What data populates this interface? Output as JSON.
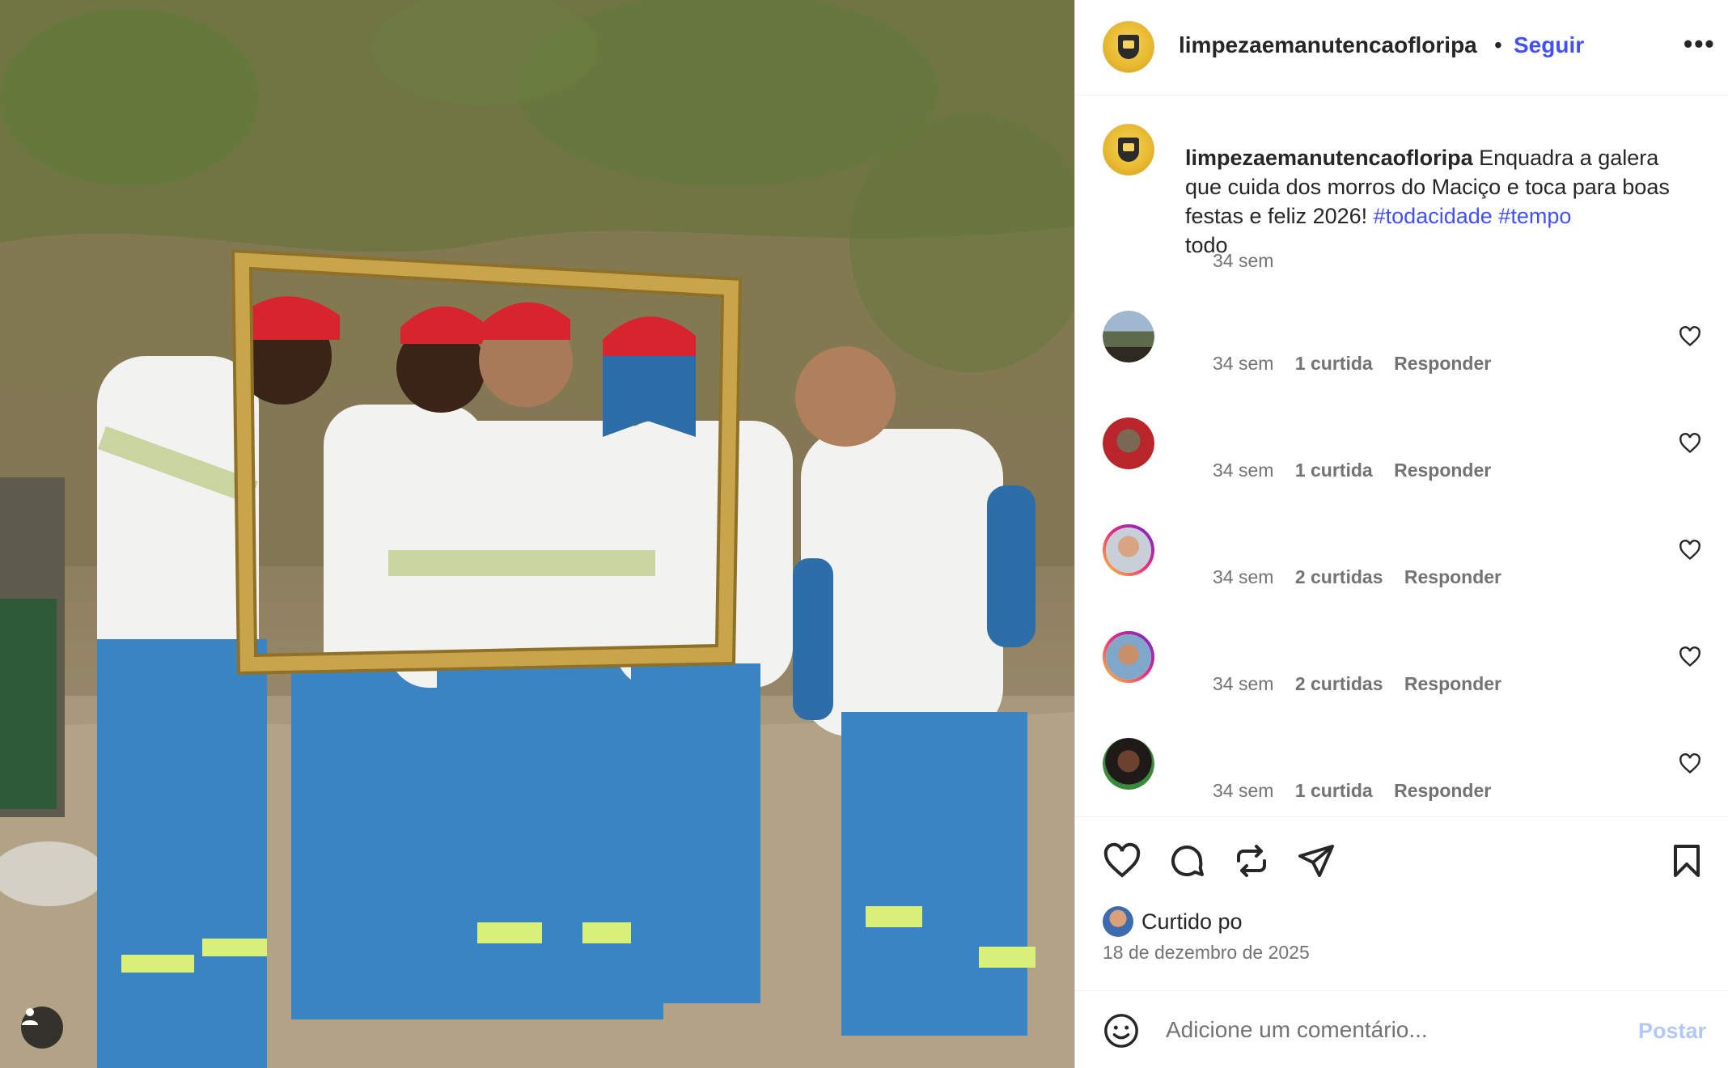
{
  "post": {
    "photo_alt": "",
    "username": "limpezaemanutencaofloripa",
    "dot": "•",
    "follow_label": "Seguir",
    "more_label": "•••"
  },
  "caption": {
    "username": "limpezaemanutencaofloripa",
    "text": " Enquadra a galera que cuida dos morros do Maciço e toca para boas festas e feliz 2026! ",
    "tag1": "#todacidade",
    "tag2": "#tempo",
    "tail": " todo",
    "time": "34 sem"
  },
  "comments": [
    {
      "time": "34 sem",
      "likes": "1 curtida",
      "reply": "Responder",
      "avatar": "landscape",
      "ring": false
    },
    {
      "time": "34 sem",
      "likes": "1 curtida",
      "reply": "Responder",
      "avatar": "dog-red",
      "ring": false
    },
    {
      "time": "34 sem",
      "likes": "2 curtidas",
      "reply": "Responder",
      "avatar": "man-tan",
      "ring": true
    },
    {
      "time": "34 sem",
      "likes": "2 curtidas",
      "reply": "Responder",
      "avatar": "man-bald",
      "ring": true
    },
    {
      "time": "34 sem",
      "likes": "1 curtida",
      "reply": "Responder",
      "avatar": "woman-curly",
      "ring": false
    }
  ],
  "actions": {
    "like": "heart-icon",
    "comment": "comment-icon",
    "repost": "repost-icon",
    "share": "send-icon",
    "save": "bookmark-icon"
  },
  "liked_by": "Curtido po",
  "date": "18 de dezembro de 2025",
  "comment_box": {
    "placeholder": "Adicione um comentário...",
    "post_label": "Postar"
  },
  "colors": {
    "link": "#4150f7",
    "muted": "#737373",
    "post_disabled": "#b2c9f5"
  }
}
